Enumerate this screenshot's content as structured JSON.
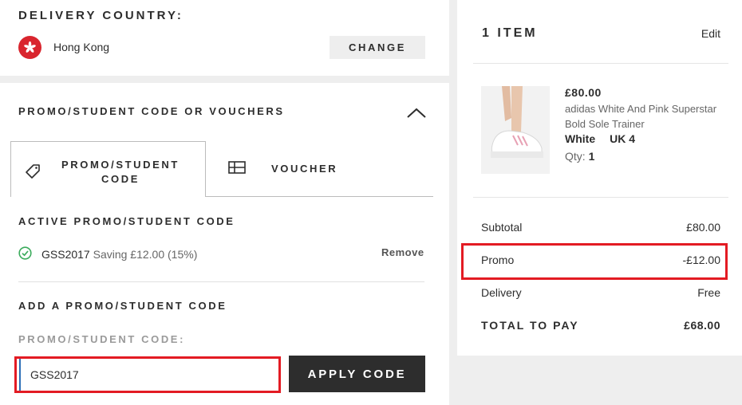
{
  "delivery": {
    "title": "DELIVERY COUNTRY:",
    "country": "Hong Kong",
    "change_label": "CHANGE",
    "flag_icon": "hong-kong-flag-icon",
    "flag_color": "#d9252e"
  },
  "promo": {
    "title": "PROMO/STUDENT CODE OR VOUCHERS",
    "tabs": [
      {
        "label": "PROMO/STUDENT CODE",
        "icon": "tag-icon",
        "active": true
      },
      {
        "label": "VOUCHER",
        "icon": "voucher-icon",
        "active": false
      }
    ],
    "active_title": "ACTIVE PROMO/STUDENT CODE",
    "active_code": "GSS2017",
    "active_saving": "Saving £12.00 (15%)",
    "remove_label": "Remove",
    "add_title": "ADD A PROMO/STUDENT CODE",
    "field_label": "PROMO/STUDENT CODE:",
    "field_value": "GSS2017",
    "apply_label": "APPLY CODE"
  },
  "summary": {
    "items_title": "1 ITEM",
    "edit_label": "Edit",
    "item": {
      "price": "£80.00",
      "name": "adidas White And Pink Superstar Bold Sole Trainer",
      "colour": "White",
      "size": "UK 4",
      "qty_label": "Qty:",
      "qty": "1"
    },
    "rows": [
      {
        "label": "Subtotal",
        "value": "£80.00"
      },
      {
        "label": "Promo",
        "value": "-£12.00"
      },
      {
        "label": "Delivery",
        "value": "Free"
      }
    ],
    "total": {
      "label": "TOTAL TO PAY",
      "value": "£68.00"
    }
  },
  "colors": {
    "highlight": "#e31b23",
    "button_dark": "#2d2d2d",
    "success_green": "#3bab5c"
  }
}
